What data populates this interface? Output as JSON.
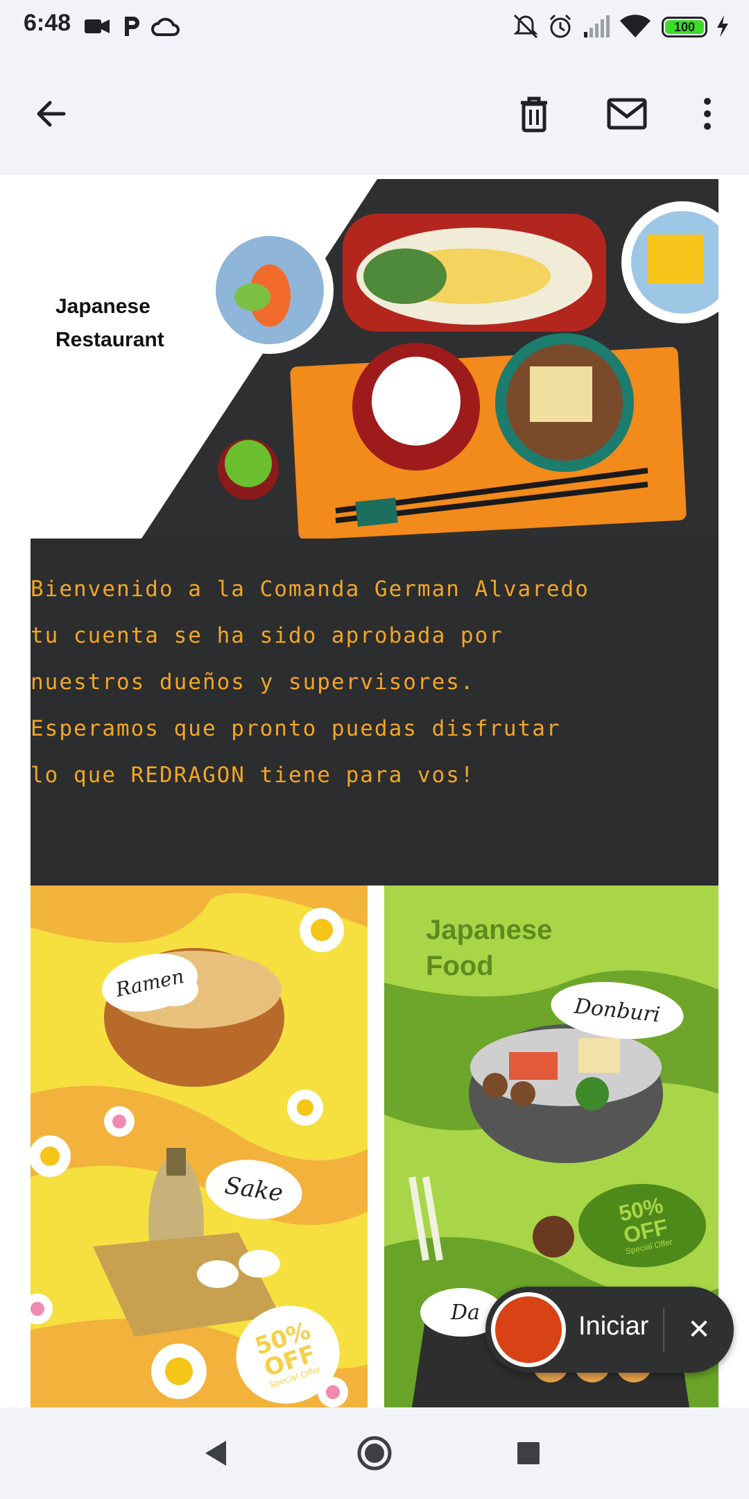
{
  "status_bar": {
    "time": "6:48",
    "battery": "100",
    "icons": [
      "video-camera-icon",
      "parking-icon",
      "cloud-icon",
      "bell-off-icon",
      "alarm-icon",
      "signal-icon",
      "wifi-icon",
      "battery-icon",
      "charging-icon"
    ]
  },
  "app_bar": {
    "icons": [
      "back-arrow-icon",
      "trash-icon",
      "mail-icon",
      "more-vert-icon"
    ]
  },
  "email": {
    "banner_title": "Japanese\nRestaurant",
    "welcome_text": "Bienvenido a la Comanda German Alvaredo\ntu cuenta se ha sido aprobada por\nnuestros dueños y supervisores.\nEsperamos que pronto puedas disfrutar\nlo que REDRAGON tiene para vos!",
    "poster_left": {
      "labels": [
        "Ramen",
        "Sake"
      ],
      "offer": "50%\nOFF",
      "offer_sub": "Special Offer"
    },
    "poster_right": {
      "heading": "Japanese\nFood",
      "labels": [
        "Donburi",
        "Da"
      ],
      "offer": "50%\nOFF",
      "offer_sub": "Special Offer"
    }
  },
  "recorder": {
    "start_label": "Iniciar",
    "close_label": "✕"
  },
  "colors": {
    "welcome_text": "#f3a623",
    "dark_block": "#2b2d2f",
    "poster_left_bg": "#f6e040",
    "poster_right_bg": "#a8d648",
    "record_dot": "#d84315"
  }
}
